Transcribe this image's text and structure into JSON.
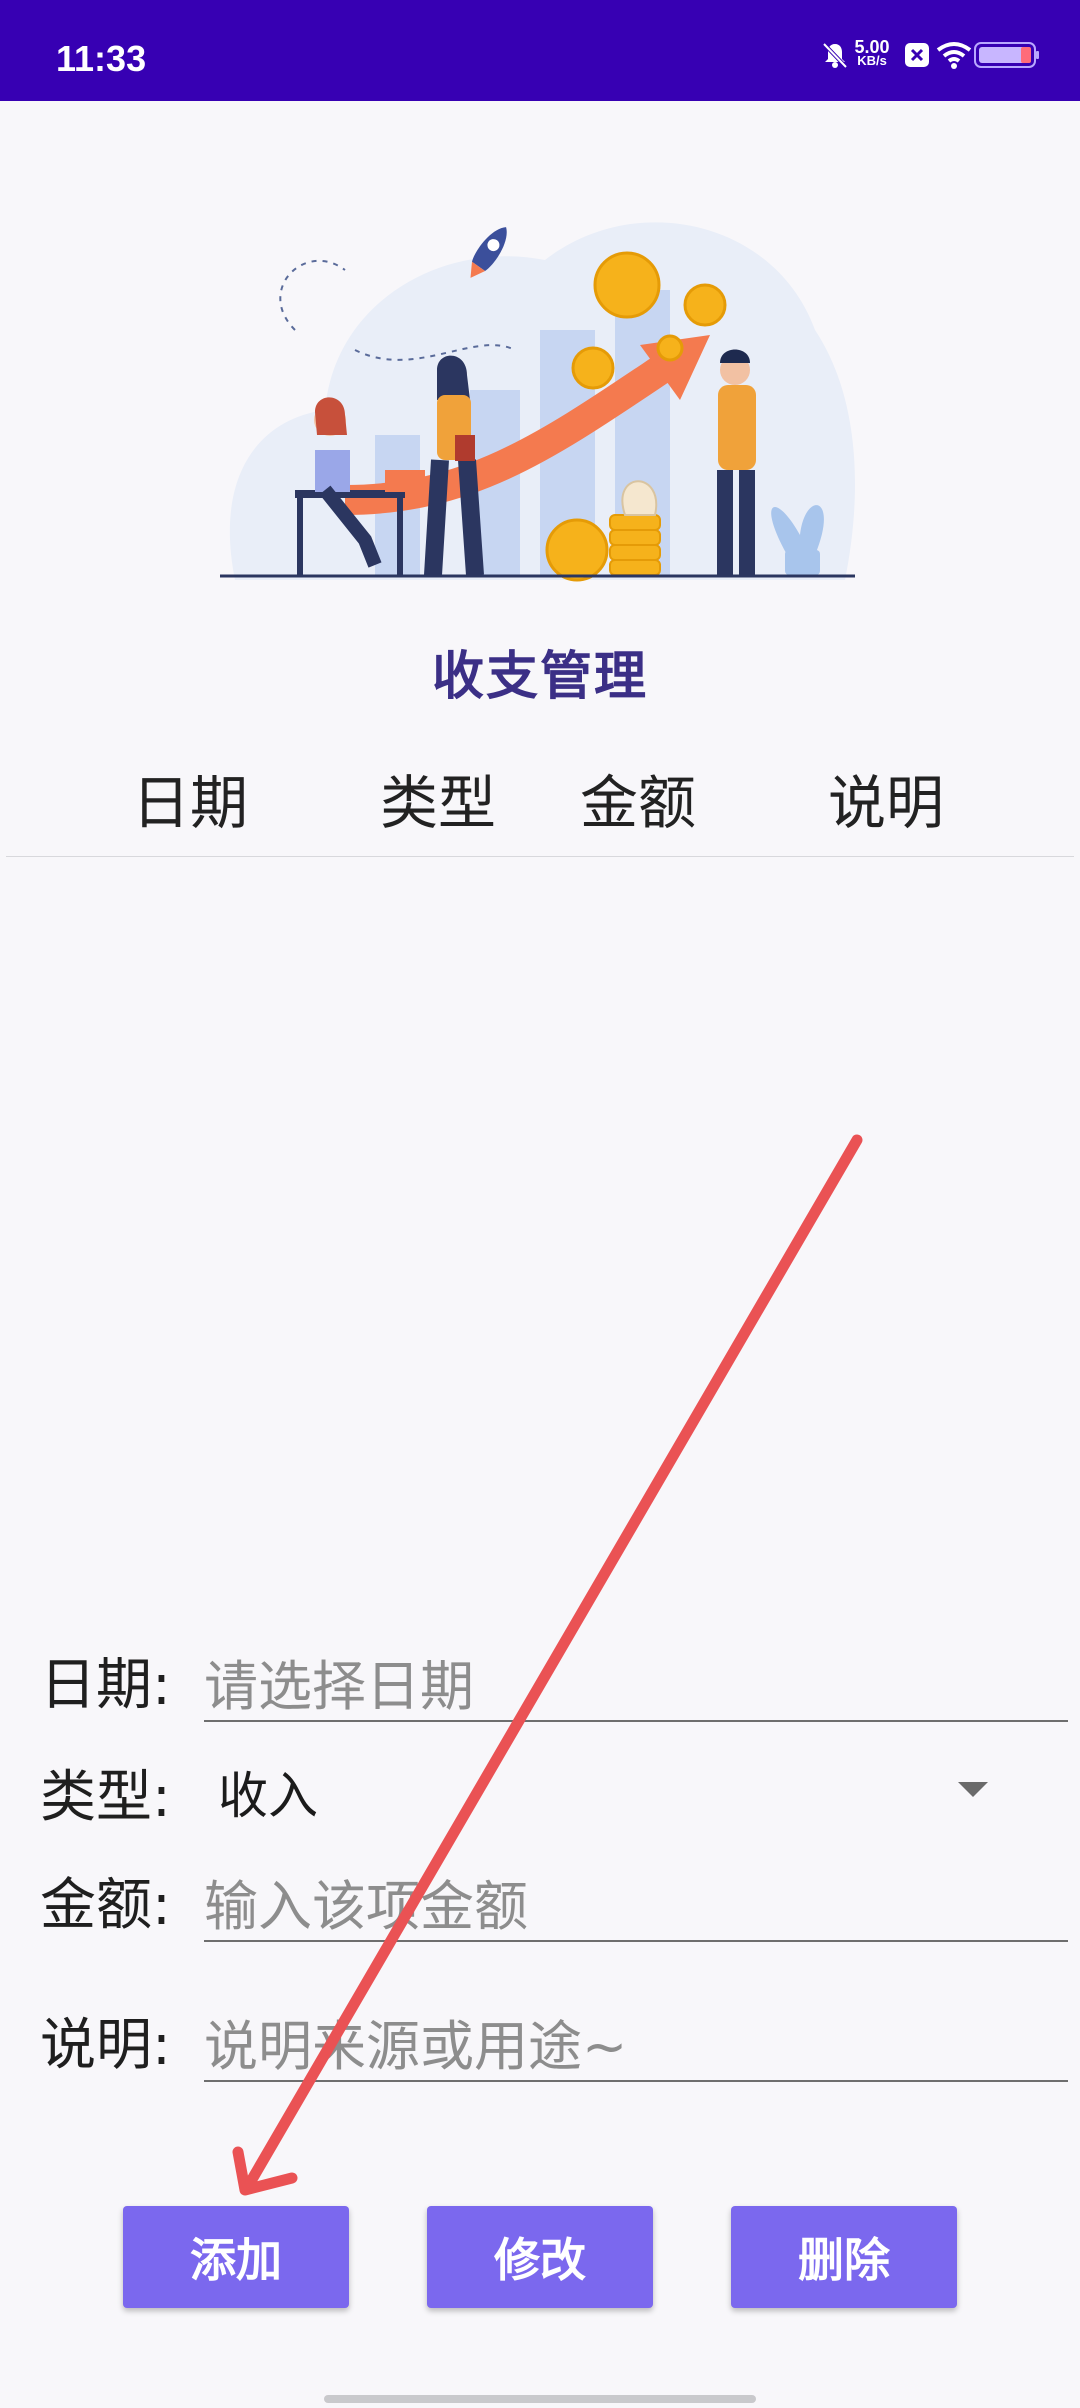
{
  "status_bar": {
    "time": "11:33",
    "net_speed_value": "5.00",
    "net_speed_unit": "KB/s",
    "icons": [
      "bell-muted-icon",
      "x-app-icon",
      "wifi-icon",
      "battery-icon"
    ]
  },
  "app": {
    "title": "收支管理",
    "accent_color": "#3700b3",
    "button_color": "#7b68ee"
  },
  "table": {
    "columns": [
      "日期",
      "类型",
      "金额",
      "说明"
    ],
    "rows": []
  },
  "form": {
    "date": {
      "label": "日期:",
      "placeholder": "请选择日期"
    },
    "type": {
      "label": "类型:",
      "value": "收入"
    },
    "amount": {
      "label": "金额:",
      "placeholder": "输入该项金额"
    },
    "note": {
      "label": "说明:",
      "placeholder": "说明来源或用途~"
    }
  },
  "buttons": {
    "add": "添加",
    "edit": "修改",
    "delete": "删除"
  }
}
